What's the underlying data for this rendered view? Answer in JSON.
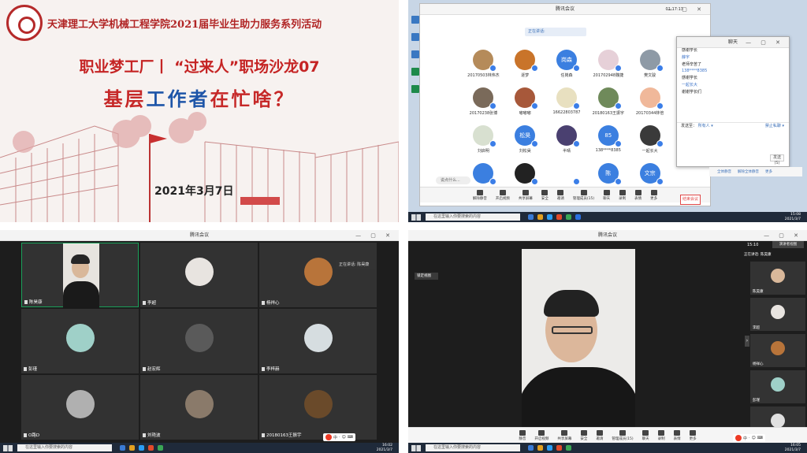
{
  "poster": {
    "school": "天津理工大学机械工程学院2021届毕业生助力服务系列活动",
    "title": "职业梦工厂丨 “过来人”职场沙龙07",
    "subtitle_red": "基层",
    "subtitle_blue": "工作者",
    "subtitle_red2": "在忙啥？",
    "date": "2021年3月7日"
  },
  "meeting": {
    "title": "腾讯会议",
    "timer": "01:17:13",
    "speaking": "正在讲话:",
    "chat_placeholder": "说点什么...",
    "end_label": "结束会议",
    "toolbar": [
      "解除静音",
      "开启视频",
      "共享屏幕",
      "安全",
      "邀请",
      "管理成员(15)",
      "聊天",
      "录制",
      "表情",
      "更多"
    ],
    "toolbar_q4": [
      "静音",
      "开启视频",
      "共享屏幕",
      "安全",
      "邀请",
      "管理成员(15)",
      "聊天",
      "录制",
      "表情",
      "更多"
    ],
    "participants": [
      {
        "name": "20170503林伟杰",
        "color": "#b58b5a",
        "text": ""
      },
      {
        "name": "逐梦",
        "color": "#c9742a",
        "text": ""
      },
      {
        "name": "任岗森",
        "color": "#3b7fe0",
        "text": "岗森"
      },
      {
        "name": "201702948魏捷",
        "color": "#e6d0d8",
        "text": ""
      },
      {
        "name": "樊文骏",
        "color": "#8e9aa6",
        "text": ""
      },
      {
        "name": "20170238张博",
        "color": "#7a6a5a",
        "text": ""
      },
      {
        "name": "嘟嘟嘟",
        "color": "#a7583a",
        "text": ""
      },
      {
        "name": "16622803787",
        "color": "#e8e0c0",
        "text": ""
      },
      {
        "name": "20180163王振宇",
        "color": "#6f8a5a",
        "text": ""
      },
      {
        "name": "20170344林倍",
        "color": "#f0b89a",
        "text": ""
      },
      {
        "name": "刘启明",
        "color": "#d8e0d0",
        "text": ""
      },
      {
        "name": "刘松昊",
        "color": "#3b7fe0",
        "text": "松昊"
      },
      {
        "name": "半晴",
        "color": "#4a4070",
        "text": ""
      },
      {
        "name": "138****8385",
        "color": "#3b7fe0",
        "text": "85"
      },
      {
        "name": "一起长大",
        "color": "#3a3a3a",
        "text": ""
      },
      {
        "name": "",
        "color": "#3b7fe0",
        "text": ""
      },
      {
        "name": "",
        "color": "#222222",
        "text": ""
      },
      {
        "name": "",
        "color": "#ffffff",
        "text": ""
      },
      {
        "name": "",
        "color": "#3b7fe0",
        "text": "陈"
      },
      {
        "name": "",
        "color": "#3b7fe0",
        "text": "文宗"
      }
    ]
  },
  "chat": {
    "title": "聊天",
    "messages": [
      {
        "type": "n",
        "text": "杨立民"
      },
      {
        "type": "m",
        "text": "感谢学长"
      },
      {
        "type": "n",
        "text": "薛宇"
      },
      {
        "type": "m",
        "text": "老师辛苦了"
      },
      {
        "type": "n",
        "text": "138****8385"
      },
      {
        "type": "m",
        "text": "感谢学长"
      },
      {
        "type": "n",
        "text": "一起长大"
      },
      {
        "type": "m",
        "text": "谢谢学长们"
      }
    ],
    "send_to": "发送至：",
    "send_target": "所有人 ▾",
    "ban_label": "禁止私聊 ▾",
    "send_button": "发送(S)",
    "bar_items": [
      "全体静音",
      "解除全体静音",
      "更多"
    ]
  },
  "gallery": {
    "speaking": "正在讲话: 陈昊康",
    "tiles": [
      {
        "name": "陈昊康",
        "color": "",
        "video": true
      },
      {
        "name": "李超",
        "color": "#e8e4e0",
        "video": false
      },
      {
        "name": "杨祥心",
        "color": "#b8743a",
        "video": false
      },
      {
        "name": "彭瑾",
        "color": "#9fd0c8",
        "video": false
      },
      {
        "name": "赵宏辉",
        "color": "#5a5a5a",
        "video": false
      },
      {
        "name": "李梓赫",
        "color": "#d6dde0",
        "video": false
      },
      {
        "name": "O路D",
        "color": "#b0b0b0",
        "video": false
      },
      {
        "name": "刘艳波",
        "color": "#8a7a6a",
        "video": false
      },
      {
        "name": "20180163王振宇",
        "color": "#6a4a2a",
        "video": false
      }
    ]
  },
  "speaker_view": {
    "time": "15:10",
    "layout": "演讲者视图",
    "speaking": "正在讲话: 陈昊康",
    "pip_label": "锁定视图",
    "side": [
      {
        "name": "陈昊康",
        "color": "#d9b89a"
      },
      {
        "name": "李超",
        "color": "#e8e4e0"
      },
      {
        "name": "杨祥心",
        "color": "#b8743a"
      },
      {
        "name": "彭瑾",
        "color": "#9fd0c8"
      },
      {
        "name": "赵宏辉",
        "color": "#e0e0e0"
      }
    ]
  },
  "taskbar": {
    "search_placeholder": "在这里输入你要搜索的内容",
    "time_q2": "15:08",
    "time_q3": "16:02",
    "time_q4": "16:05",
    "date": "2021/3/7",
    "ime": [
      "中",
      "·",
      "☺",
      "⌨"
    ]
  }
}
